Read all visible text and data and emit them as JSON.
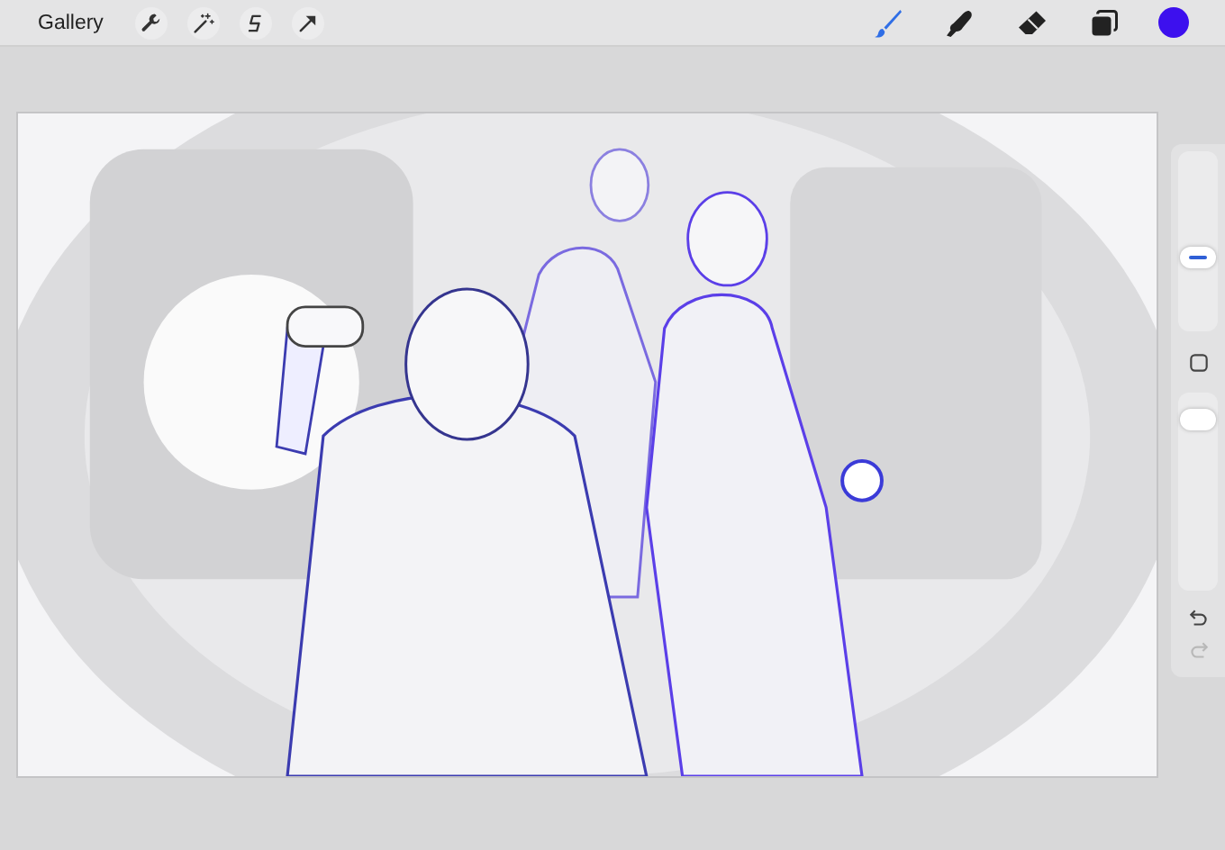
{
  "top_bar": {
    "gallery": "Gallery",
    "actions": [
      {
        "kind": "wrench"
      },
      {
        "kind": "wand"
      },
      {
        "kind": "selection"
      },
      {
        "kind": "transform"
      }
    ],
    "tools": [
      {
        "kind": "brush",
        "selected": true
      },
      {
        "kind": "smudge",
        "selected": false
      },
      {
        "kind": "eraser",
        "selected": false
      },
      {
        "kind": "layers",
        "selected": false
      }
    ],
    "color": "#3d10ee"
  },
  "sidebar": {
    "size_slider": {
      "level": 0.38
    },
    "opacity_slider": {
      "level": 0.9
    },
    "undo": {
      "disabled": false
    },
    "redo": {
      "disabled": true
    }
  }
}
